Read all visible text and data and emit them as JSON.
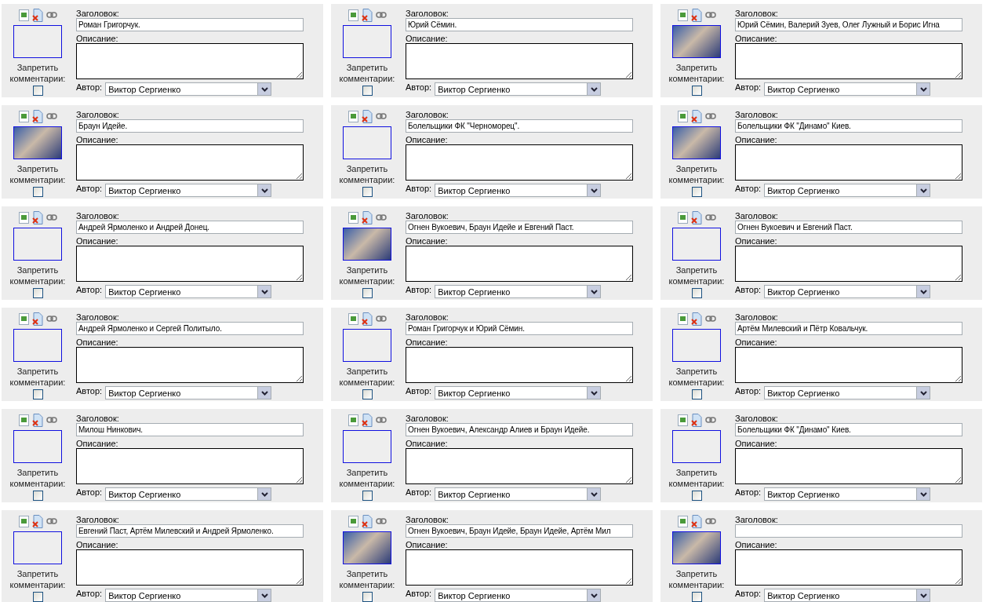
{
  "cards": [
    {
      "title_label": "Заголовок:",
      "title": "Роман Григорчук.",
      "description_label": "Описание:",
      "author_label": "Автор:",
      "author": "Виктор Сергиенко",
      "photo": false,
      "no_comments_label": "Запретить комментарии:",
      "comments_disabled": false
    },
    {
      "title_label": "Заголовок:",
      "title": "Юрий Сёмин.",
      "description_label": "Описание:",
      "author_label": "Автор:",
      "author": "Виктор Сергиенко",
      "photo": false,
      "no_comments_label": "Запретить комментарии:",
      "comments_disabled": false
    },
    {
      "title_label": "Заголовок:",
      "title": "Юрий Сёмин, Валерий Зуев, Олег Лужный и Борис Игна",
      "description_label": "Описание:",
      "author_label": "Автор:",
      "author": "Виктор Сергиенко",
      "photo": true,
      "no_comments_label": "Запретить комментарии:",
      "comments_disabled": false
    },
    {
      "title_label": "Заголовок:",
      "title": "Браун Идейе.",
      "description_label": "Описание:",
      "author_label": "Автор:",
      "author": "Виктор Сергиенко",
      "photo": true,
      "no_comments_label": "Запретить комментарии:",
      "comments_disabled": false
    },
    {
      "title_label": "Заголовок:",
      "title": "Болельщики ФК \"Черноморец\".",
      "description_label": "Описание:",
      "author_label": "Автор:",
      "author": "Виктор Сергиенко",
      "photo": false,
      "no_comments_label": "Запретить комментарии:",
      "comments_disabled": false
    },
    {
      "title_label": "Заголовок:",
      "title": "Болельщики ФК \"Динамо\" Киев.",
      "description_label": "Описание:",
      "author_label": "Автор:",
      "author": "Виктор Сергиенко",
      "photo": true,
      "no_comments_label": "Запретить комментарии:",
      "comments_disabled": false
    },
    {
      "title_label": "Заголовок:",
      "title": "Андрей Ярмоленко и Андрей Донец.",
      "description_label": "Описание:",
      "author_label": "Автор:",
      "author": "Виктор Сергиенко",
      "photo": false,
      "no_comments_label": "Запретить комментарии:",
      "comments_disabled": false
    },
    {
      "title_label": "Заголовок:",
      "title": "Огнен Вукоевич, Браун Идейе и Евгений Паст.",
      "description_label": "Описание:",
      "author_label": "Автор:",
      "author": "Виктор Сергиенко",
      "photo": true,
      "no_comments_label": "Запретить комментарии:",
      "comments_disabled": false
    },
    {
      "title_label": "Заголовок:",
      "title": "Огнен Вукоевич и Евгений Паст.",
      "description_label": "Описание:",
      "author_label": "Автор:",
      "author": "Виктор Сергиенко",
      "photo": false,
      "no_comments_label": "Запретить комментарии:",
      "comments_disabled": false
    },
    {
      "title_label": "Заголовок:",
      "title": "Андрей Ярмоленко и Сергей Политыло.",
      "description_label": "Описание:",
      "author_label": "Автор:",
      "author": "Виктор Сергиенко",
      "photo": false,
      "no_comments_label": "Запретить комментарии:",
      "comments_disabled": false
    },
    {
      "title_label": "Заголовок:",
      "title": "Роман Григорчук и Юрий Сёмин.",
      "description_label": "Описание:",
      "author_label": "Автор:",
      "author": "Виктор Сергиенко",
      "photo": false,
      "no_comments_label": "Запретить комментарии:",
      "comments_disabled": false
    },
    {
      "title_label": "Заголовок:",
      "title": "Артём Милевский и Пётр Ковальчук.",
      "description_label": "Описание:",
      "author_label": "Автор:",
      "author": "Виктор Сергиенко",
      "photo": false,
      "no_comments_label": "Запретить комментарии:",
      "comments_disabled": false
    },
    {
      "title_label": "Заголовок:",
      "title": "Милош Нинкович.",
      "description_label": "Описание:",
      "author_label": "Автор:",
      "author": "Виктор Сергиенко",
      "photo": false,
      "no_comments_label": "Запретить комментарии:",
      "comments_disabled": false
    },
    {
      "title_label": "Заголовок:",
      "title": "Огнен Вукоевич, Александр Алиев и Браун Идейе.",
      "description_label": "Описание:",
      "author_label": "Автор:",
      "author": "Виктор Сергиенко",
      "photo": false,
      "no_comments_label": "Запретить комментарии:",
      "comments_disabled": false
    },
    {
      "title_label": "Заголовок:",
      "title": "Болельщики ФК \"Динамо\" Киев.",
      "description_label": "Описание:",
      "author_label": "Автор:",
      "author": "Виктор Сергиенко",
      "photo": false,
      "no_comments_label": "Запретить комментарии:",
      "comments_disabled": false
    },
    {
      "title_label": "Заголовок:",
      "title": "Евгений Паст, Артём Милевский и Андрей Ярмоленко.",
      "description_label": "Описание:",
      "author_label": "Автор:",
      "author": "Виктор Сергиенко",
      "photo": false,
      "no_comments_label": "Запретить комментарии:",
      "comments_disabled": false
    },
    {
      "title_label": "Заголовок:",
      "title": "Огнен Вукоевич, Браун Идейе, Браун Идейе, Артём Мил",
      "description_label": "Описание:",
      "author_label": "Автор:",
      "author": "Виктор Сергиенко",
      "photo": true,
      "no_comments_label": "Запретить комментарии:",
      "comments_disabled": false
    },
    {
      "title_label": "Заголовок:",
      "description_label": "Описание:",
      "author_label": "Автор:",
      "author": "Виктор Сергиенко",
      "photo": true,
      "no_comments_label": "Запретить комментарии:",
      "comments_disabled": false
    }
  ]
}
